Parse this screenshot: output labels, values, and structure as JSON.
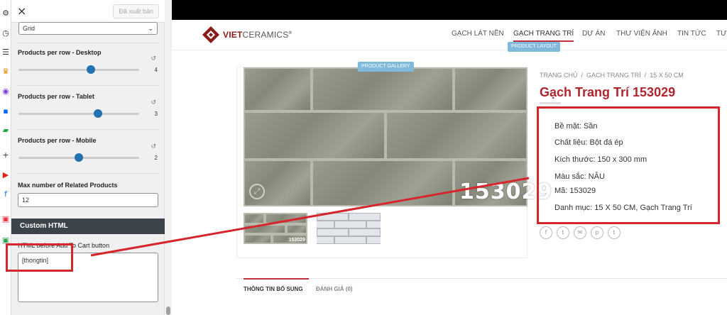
{
  "panel": {
    "close_icon": "×",
    "publish_label": "Đã xuất bản",
    "layout_select": {
      "value": "Grid"
    },
    "settings": [
      {
        "label": "Products per row - Desktop",
        "value": "4",
        "level": 0.6
      },
      {
        "label": "Products per row - Tablet",
        "value": "3",
        "level": 0.66
      },
      {
        "label": "Products per row - Mobile",
        "value": "2",
        "level": 0.5
      }
    ],
    "related": {
      "label": "Max number of Related Products",
      "value": "12"
    },
    "custom_html": {
      "section_title": "Custom HTML",
      "field_label": "HTML before Add To Cart button",
      "field_value": "[thongtin]"
    }
  },
  "site": {
    "logo": {
      "brand_part1": "VIET",
      "brand_part2": "CERAMICS",
      "trademark": "®"
    },
    "nav": [
      "GẠCH LÁT NỀN",
      "GẠCH TRANG TRÍ",
      "DỰ ÁN",
      "THƯ VIỆN ẢNH",
      "TIN TỨC",
      "TƯ"
    ],
    "layout_badge": "PRODUCT LAYOUT",
    "gallery_badge": "PRODUCT GALLERY",
    "image_code": "153029",
    "thumb_code": "153029",
    "breadcrumb": [
      "TRANG CHỦ",
      "GẠCH TRANG TRÍ",
      "15 X 50 CM"
    ],
    "breadcrumb_sep": "/",
    "title": "Gạch Trang Trí 153029",
    "info": [
      "Bề mặt: Sần",
      "Chất liệu: Bột đá ép",
      "Kích thước: 150 x 300 mm",
      "Màu sắc: NÂU",
      "Mã: 153029",
      "Danh mục: 15 X 50 CM, Gạch Trang Trí"
    ],
    "share_icons": [
      "f",
      "t",
      "✉",
      "p",
      "t"
    ],
    "tabs": [
      "THÔNG TIN BỔ SUNG",
      "ĐÁNH GIÁ (0)"
    ]
  },
  "colors": {
    "accent": "#d6262d",
    "brand": "#8b1a1a",
    "wp_blue": "#2271b1"
  }
}
